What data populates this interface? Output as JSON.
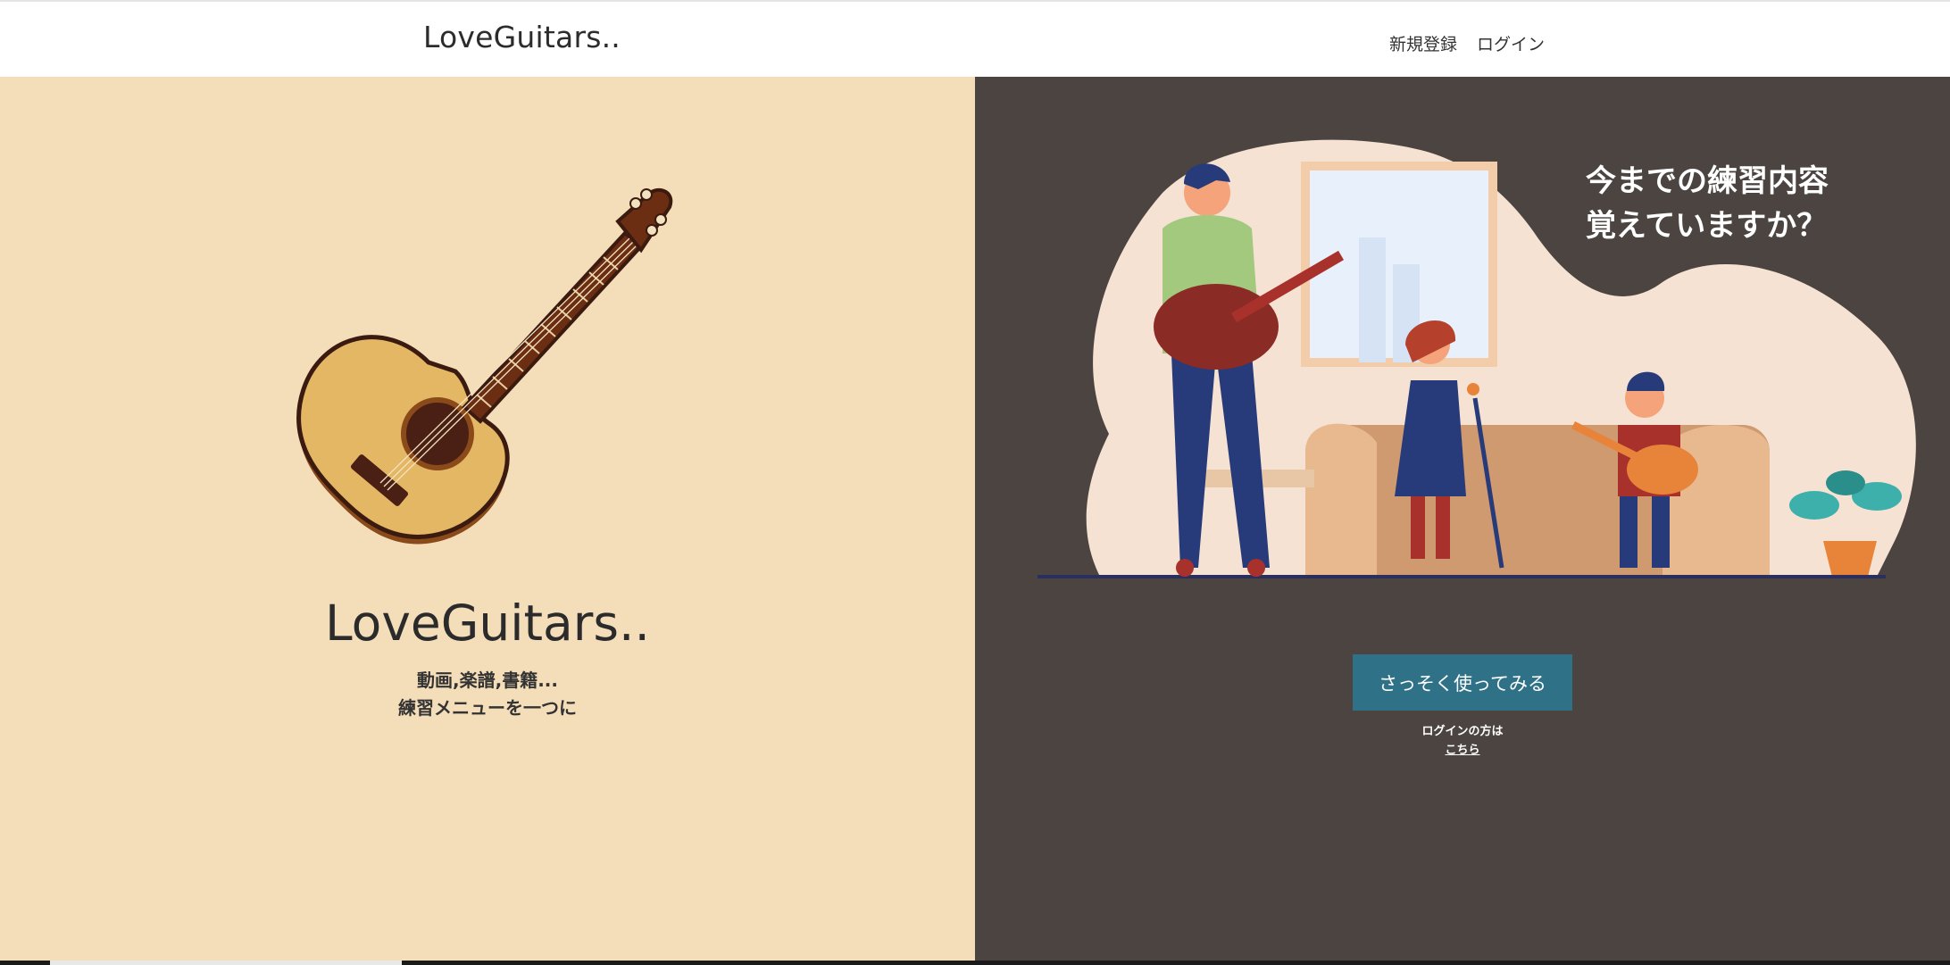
{
  "header": {
    "brand": "LoveGuitars..",
    "nav": {
      "signup": "新規登録",
      "login": "ログイン"
    }
  },
  "hero_left": {
    "title": "LoveGuitars..",
    "subtitle_line1": "動画,楽譜,書籍...",
    "subtitle_line2": "練習メニューを一つに"
  },
  "hero_right": {
    "headline_line1": "今までの練習内容",
    "headline_line2": "覚えていますか？",
    "cta_label": "さっそく使ってみる",
    "login_note": "ログインの方は",
    "login_link": "こちら"
  },
  "colors": {
    "left_bg": "#f4ddb9",
    "right_bg": "#4b4440",
    "cta_bg": "#2f7187"
  },
  "icons": {
    "guitar": "guitar-illustration",
    "band": "family-band-illustration"
  }
}
